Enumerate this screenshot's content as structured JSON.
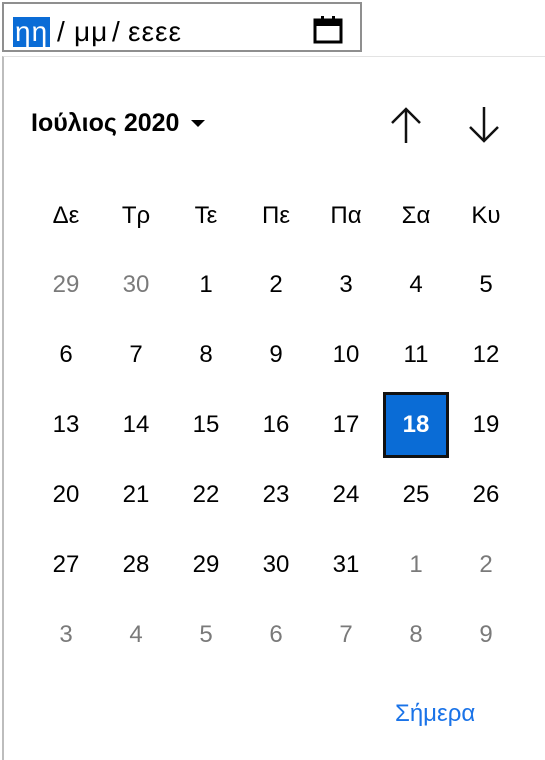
{
  "date_input": {
    "day_placeholder": "ηη",
    "month_placeholder": "μμ",
    "year_placeholder": "εεεε",
    "separator": "/"
  },
  "calendar": {
    "month_year": "Ιούλιος 2020",
    "weekdays": [
      "Δε",
      "Τρ",
      "Τε",
      "Πε",
      "Πα",
      "Σα",
      "Κυ"
    ],
    "weeks": [
      [
        {
          "d": "29",
          "o": true
        },
        {
          "d": "30",
          "o": true
        },
        {
          "d": "1"
        },
        {
          "d": "2"
        },
        {
          "d": "3"
        },
        {
          "d": "4"
        },
        {
          "d": "5"
        }
      ],
      [
        {
          "d": "6"
        },
        {
          "d": "7"
        },
        {
          "d": "8"
        },
        {
          "d": "9"
        },
        {
          "d": "10"
        },
        {
          "d": "11"
        },
        {
          "d": "12"
        }
      ],
      [
        {
          "d": "13"
        },
        {
          "d": "14"
        },
        {
          "d": "15"
        },
        {
          "d": "16"
        },
        {
          "d": "17"
        },
        {
          "d": "18",
          "s": true
        },
        {
          "d": "19"
        }
      ],
      [
        {
          "d": "20"
        },
        {
          "d": "21"
        },
        {
          "d": "22"
        },
        {
          "d": "23"
        },
        {
          "d": "24"
        },
        {
          "d": "25"
        },
        {
          "d": "26"
        }
      ],
      [
        {
          "d": "27"
        },
        {
          "d": "28"
        },
        {
          "d": "29"
        },
        {
          "d": "30"
        },
        {
          "d": "31"
        },
        {
          "d": "1",
          "o": true
        },
        {
          "d": "2",
          "o": true
        }
      ],
      [
        {
          "d": "3",
          "o": true
        },
        {
          "d": "4",
          "o": true
        },
        {
          "d": "5",
          "o": true
        },
        {
          "d": "6",
          "o": true
        },
        {
          "d": "7",
          "o": true
        },
        {
          "d": "8",
          "o": true
        },
        {
          "d": "9",
          "o": true
        }
      ]
    ],
    "today_label": "Σήμερα"
  },
  "icons": {
    "calendar": "calendar-icon",
    "prev": "arrow-up-icon",
    "next": "arrow-down-icon",
    "dropdown": "chevron-down-icon"
  },
  "colors": {
    "selected_bg": "#0a6cd6",
    "link": "#1a73e8",
    "muted": "#7a7a7a"
  }
}
